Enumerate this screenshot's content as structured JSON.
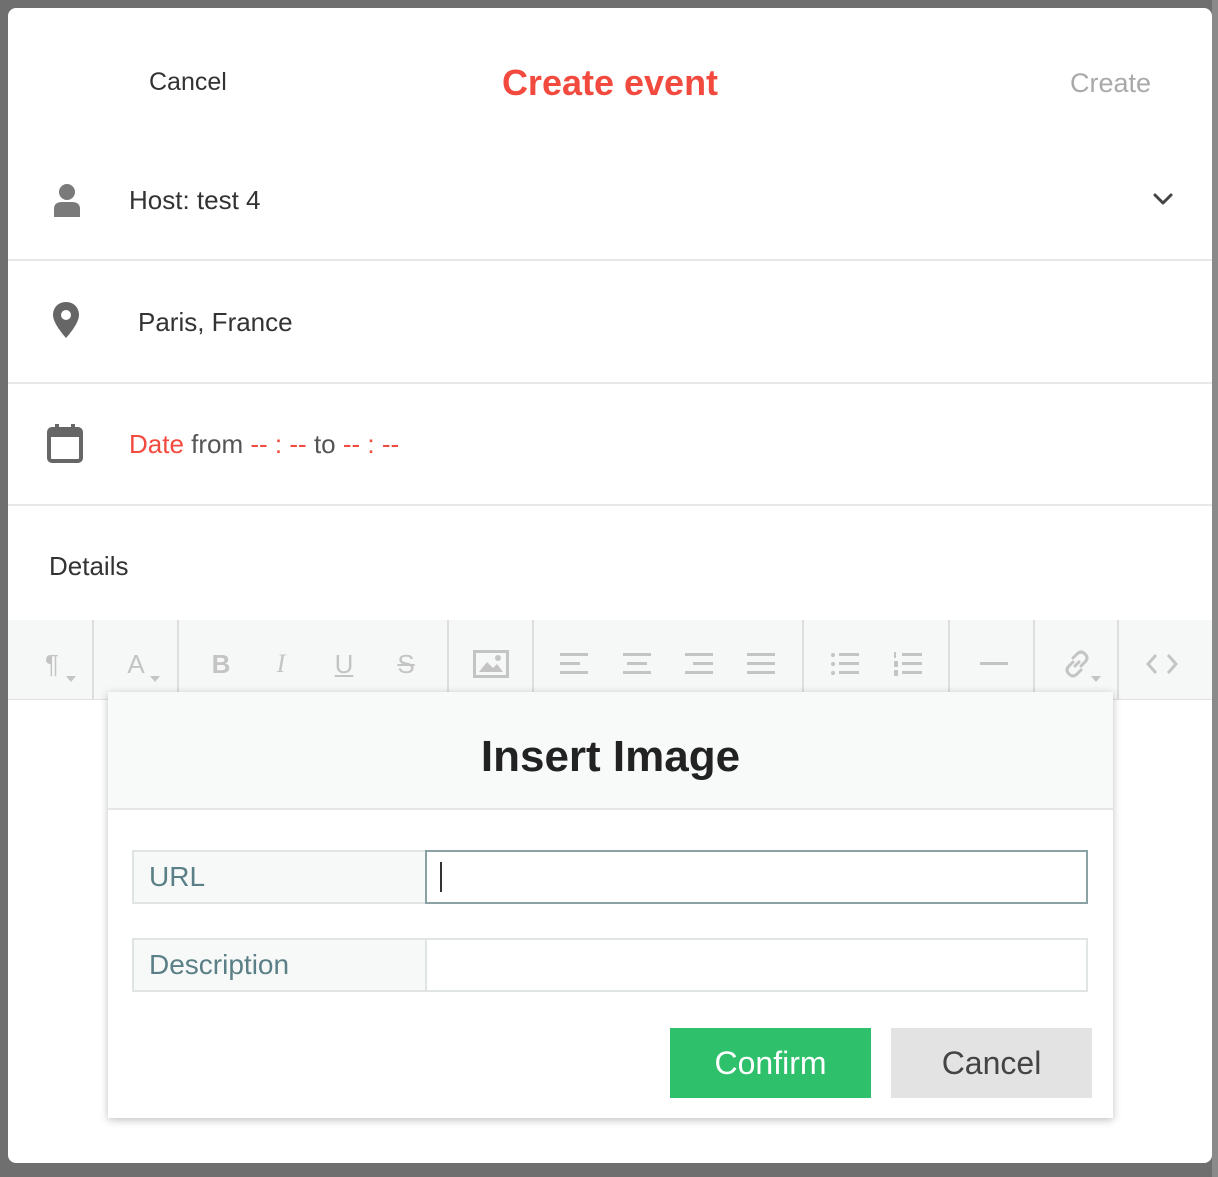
{
  "header": {
    "cancel_label": "Cancel",
    "title": "Create event",
    "create_label": "Create"
  },
  "host": {
    "label": "Host: test 4",
    "icon": "person-icon",
    "dropdown_icon": "chevron-down-icon"
  },
  "location": {
    "value": "Paris, France",
    "icon": "map-pin-icon"
  },
  "date": {
    "icon": "calendar-icon",
    "date_label": "Date",
    "from_label": "from",
    "from_value": "-- : --",
    "to_label": "to",
    "to_value": "-- : --"
  },
  "details": {
    "label": "Details"
  },
  "toolbar": {
    "paragraph": "¶",
    "font_color": "A",
    "bold": "B",
    "italic": "I",
    "underline": "U",
    "strikethrough": "S"
  },
  "insert_image_dialog": {
    "title": "Insert Image",
    "url_label": "URL",
    "url_value": "",
    "description_label": "Description",
    "description_value": "",
    "confirm_label": "Confirm",
    "cancel_label": "Cancel"
  },
  "colors": {
    "accent": "#f24a3e",
    "confirm": "#2ec06a",
    "disabled": "#a9a9a9"
  }
}
